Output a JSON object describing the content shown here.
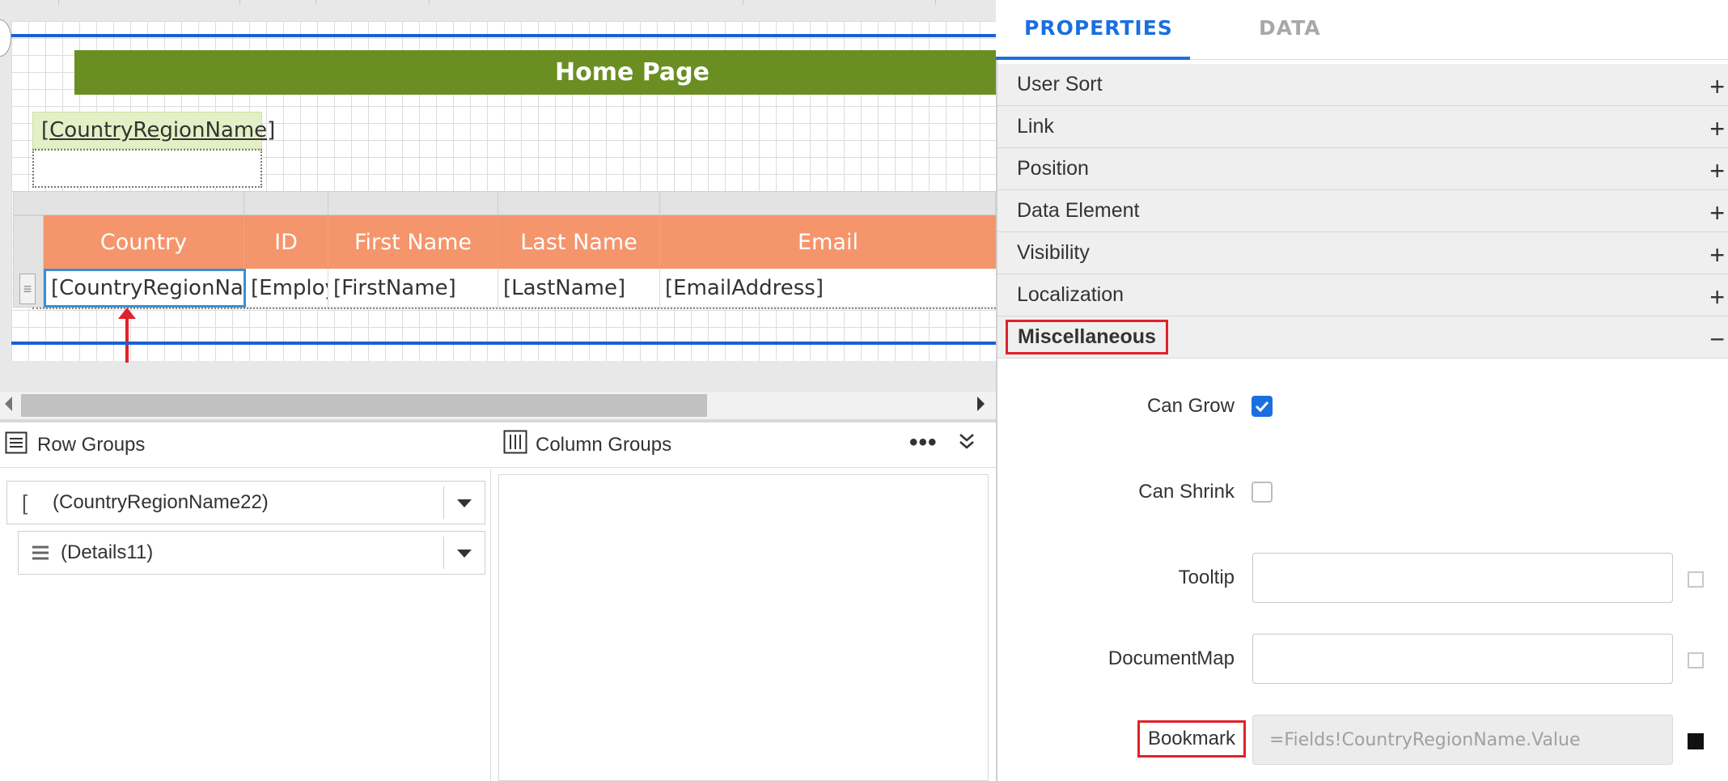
{
  "canvas": {
    "banner_text": "Home Page",
    "country_textbox": "[CountryRegionName]",
    "table": {
      "headers": [
        "Country",
        "ID",
        "First Name",
        "Last Name",
        "Email"
      ],
      "cells": [
        "[CountryRegionNam",
        "[Employ",
        "[FirstName]",
        "[LastName]",
        "[EmailAddress]"
      ],
      "row_grip_icon": "drag-lines-icon"
    }
  },
  "groups": {
    "row_groups_title": "Row Groups",
    "column_groups_title": "Column Groups",
    "more_icon": "ellipsis-icon",
    "collapse_icon": "double-chevron-down-icon",
    "row_group_items": [
      {
        "label": "(CountryRegionName22)",
        "icon": "bracket-icon"
      },
      {
        "label": "(Details11)",
        "icon": "lines-icon"
      }
    ]
  },
  "properties": {
    "tabs": [
      "PROPERTIES",
      "DATA"
    ],
    "active_tab": "PROPERTIES",
    "sections": [
      {
        "label": "User Sort",
        "expanded": false
      },
      {
        "label": "Link",
        "expanded": false
      },
      {
        "label": "Position",
        "expanded": false
      },
      {
        "label": "Data Element",
        "expanded": false
      },
      {
        "label": "Visibility",
        "expanded": false
      },
      {
        "label": "Localization",
        "expanded": false
      },
      {
        "label": "Miscellaneous",
        "expanded": true
      }
    ],
    "expand_symbol": "+",
    "collapse_symbol": "−",
    "misc": {
      "can_grow_label": "Can Grow",
      "can_grow": true,
      "can_shrink_label": "Can Shrink",
      "can_shrink": false,
      "tooltip_label": "Tooltip",
      "tooltip_value": "",
      "document_map_label": "DocumentMap",
      "document_map_value": "",
      "bookmark_label": "Bookmark",
      "bookmark_value": "=Fields!CountryRegionName.Value"
    }
  },
  "colors": {
    "accent_blue": "#1a6fe0",
    "banner_green": "#6b8e23",
    "header_orange": "#f5956b",
    "highlight_red": "#e0222a"
  }
}
